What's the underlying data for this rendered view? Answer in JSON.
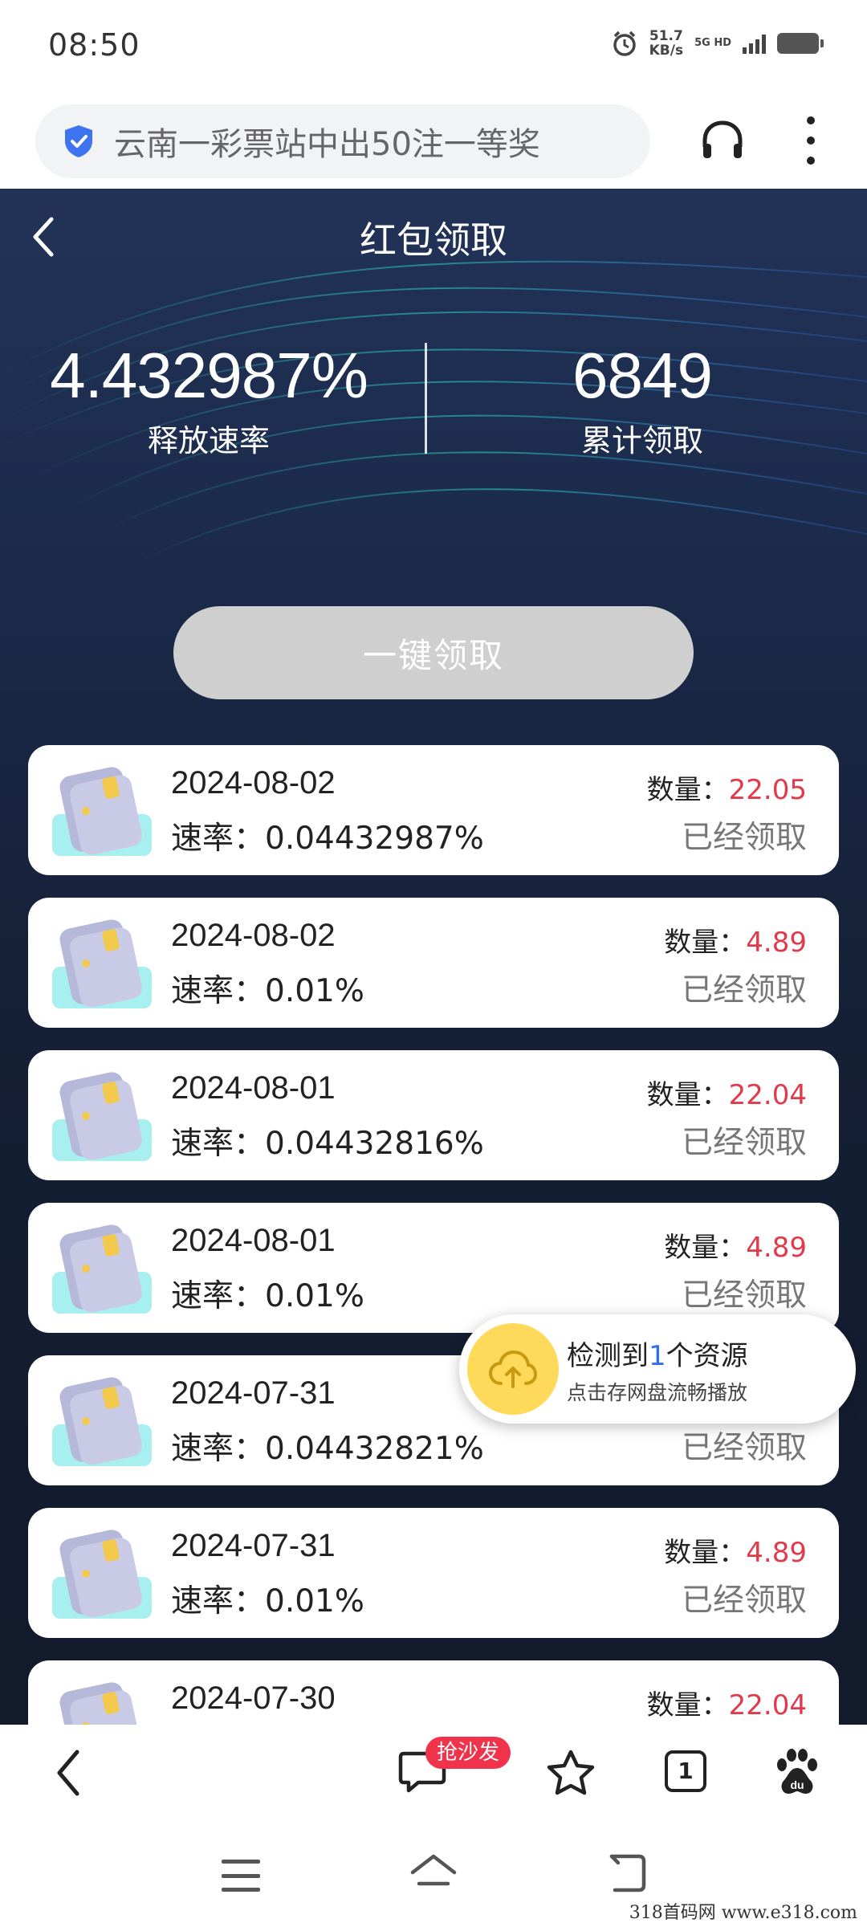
{
  "status_bar": {
    "time": "08:50",
    "net_speed": "51.7",
    "net_speed_unit": "KB/s",
    "net_type_top": "5G HD",
    "icons": [
      "alarm-icon",
      "signal-icon",
      "battery-icon"
    ]
  },
  "browser": {
    "search_text": "云南一彩票站中出50注一等奖",
    "icons": [
      "shield-icon",
      "headphone-icon",
      "more-icon"
    ]
  },
  "page": {
    "title": "红包领取",
    "release_rate_value": "4.432987%",
    "release_rate_label": "释放速率",
    "total_claimed_value": "6849",
    "total_claimed_label": "累计领取",
    "claim_button": "一键领取"
  },
  "records": {
    "qty_label": "数量：",
    "rate_prefix": "速率：",
    "items": [
      {
        "date": "2024-08-02",
        "rate": "0.04432987%",
        "qty": "22.05",
        "status": "已经领取"
      },
      {
        "date": "2024-08-02",
        "rate": "0.01%",
        "qty": "4.89",
        "status": "已经领取"
      },
      {
        "date": "2024-08-01",
        "rate": "0.04432816%",
        "qty": "22.04",
        "status": "已经领取"
      },
      {
        "date": "2024-08-01",
        "rate": "0.01%",
        "qty": "4.89",
        "status": "已经领取"
      },
      {
        "date": "2024-07-31",
        "rate": "0.04432821%",
        "qty": "",
        "status": "已经领取"
      },
      {
        "date": "2024-07-31",
        "rate": "0.01%",
        "qty": "4.89",
        "status": "已经领取"
      },
      {
        "date": "2024-07-30",
        "rate": "",
        "qty": "22.04",
        "status": ""
      }
    ]
  },
  "floating": {
    "title_prefix": "检测到",
    "count": "1",
    "title_suffix": "个资源",
    "subtitle": "点击存网盘流畅播放"
  },
  "toolbar": {
    "sofa_badge": "抢沙发",
    "tab_count": "1"
  },
  "watermark": "318首码网  www.e318.com",
  "colors": {
    "accent_red": "#e23a4b",
    "badge_red": "#f0334a",
    "link_blue": "#2f6df6",
    "page_bg": "#1b2a4a"
  }
}
